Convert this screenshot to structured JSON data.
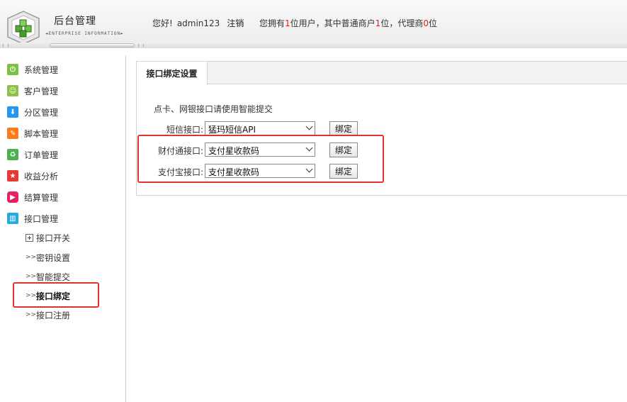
{
  "header": {
    "title": "后台管理",
    "subtitle": "◄ENTERPRISE INFORMATION►",
    "greeting": "您好!",
    "username": "admin123",
    "logout": "注销",
    "stats_prefix": "您拥有",
    "user_count": "1",
    "stats_mid": "位用户，其中普通商户",
    "merchant_count": "1",
    "stats_mid2": "位，代理商",
    "agent_count": "0",
    "stats_suffix": "位"
  },
  "sidebar": {
    "items": [
      {
        "label": "系统管理",
        "icon": "power-icon",
        "color": "#7cc242"
      },
      {
        "label": "客户管理",
        "icon": "smile-icon",
        "color": "#8bc34a"
      },
      {
        "label": "分区管理",
        "icon": "download-icon",
        "color": "#2196f3"
      },
      {
        "label": "脚本管理",
        "icon": "pencil-icon",
        "color": "#ff7a1a"
      },
      {
        "label": "订单管理",
        "icon": "recycle-icon",
        "color": "#4caf50"
      },
      {
        "label": "收益分析",
        "icon": "star-icon",
        "color": "#e53935"
      },
      {
        "label": "结算管理",
        "icon": "play-icon",
        "color": "#e91e63"
      },
      {
        "label": "接口管理",
        "icon": "grid-icon",
        "color": "#29a8e0"
      }
    ],
    "sub_items": [
      {
        "label": "接口开关",
        "marker": "box"
      },
      {
        "label": "密钥设置",
        "marker": ">>"
      },
      {
        "label": "智能提交",
        "marker": ">>"
      },
      {
        "label": "接口绑定",
        "marker": ">>"
      },
      {
        "label": "接口注册",
        "marker": ">>"
      }
    ]
  },
  "main": {
    "tab": "接口绑定设置",
    "note": "点卡、网银接口请使用智能提交",
    "rows": [
      {
        "label": "短信接口:",
        "value": "猛玛短信API",
        "button": "绑定"
      },
      {
        "label": "财付通接口:",
        "value": "支付星收款码",
        "button": "绑定"
      },
      {
        "label": "支付宝接口:",
        "value": "支付星收款码",
        "button": "绑定"
      }
    ]
  },
  "colors": {
    "highlight": "#e03030",
    "count": "#e02020"
  }
}
